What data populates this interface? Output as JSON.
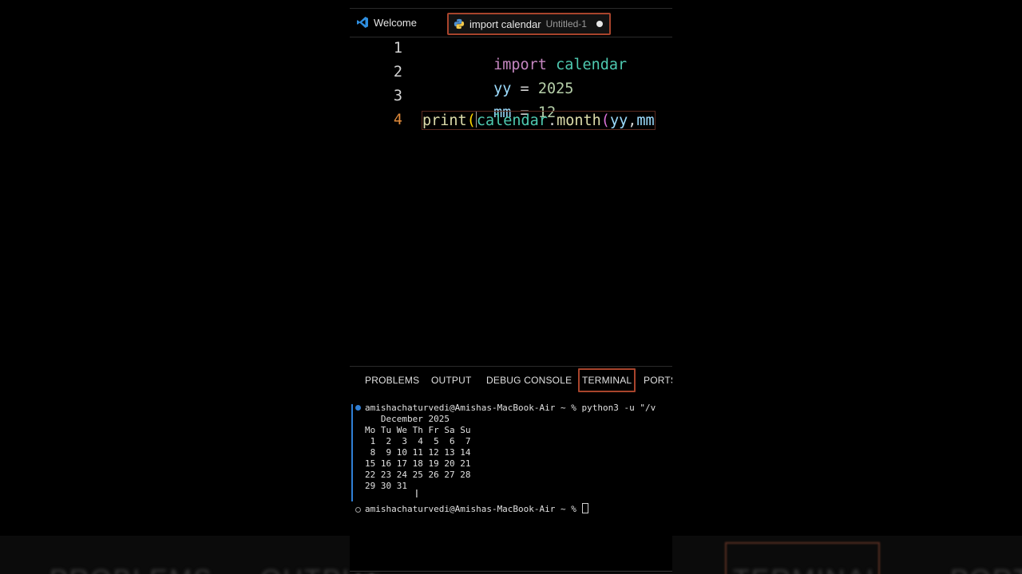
{
  "tabs": {
    "welcome": "Welcome",
    "active_title": "import calendar",
    "active_sub": "Untitled-1"
  },
  "editor": {
    "lines": [
      {
        "n": "1",
        "tokens": [
          {
            "t": "import",
            "c": "kw"
          },
          {
            "t": " ",
            "c": "op"
          },
          {
            "t": "calendar",
            "c": "mod"
          }
        ]
      },
      {
        "n": "2",
        "tokens": [
          {
            "t": "yy",
            "c": "var"
          },
          {
            "t": " = ",
            "c": "op"
          },
          {
            "t": "2025",
            "c": "num"
          }
        ]
      },
      {
        "n": "3",
        "tokens": [
          {
            "t": "mm",
            "c": "var"
          },
          {
            "t": " = ",
            "c": "op"
          },
          {
            "t": "12",
            "c": "num"
          }
        ]
      },
      {
        "n": "4",
        "tokens": [
          {
            "t": "print",
            "c": "fn"
          },
          {
            "t": "(",
            "c": "par"
          },
          {
            "t": "calendar",
            "c": "mod"
          },
          {
            "t": ".",
            "c": "op"
          },
          {
            "t": "month",
            "c": "fn"
          },
          {
            "t": "(",
            "c": "par2"
          },
          {
            "t": "yy",
            "c": "var"
          },
          {
            "t": ",",
            "c": "op"
          },
          {
            "t": "mm",
            "c": "var"
          }
        ]
      }
    ]
  },
  "panel": {
    "problems": "PROBLEMS",
    "output": "OUTPUT",
    "debug": "DEBUG CONSOLE",
    "terminal": "TERMINAL",
    "ports": "PORTS"
  },
  "terminal": {
    "command_line": "amishachaturvedi@Amishas-MacBook-Air ~ % python3 -u \"/v",
    "output": [
      "   December 2025",
      "Mo Tu We Th Fr Sa Su",
      " 1  2  3  4  5  6  7",
      " 8  9 10 11 12 13 14",
      "15 16 17 18 19 20 21",
      "22 23 24 25 26 27 28",
      "29 30 31"
    ],
    "prompt": "amishachaturvedi@Amishas-MacBook-Air ~ % "
  },
  "background": {
    "words": [
      "PROBLEMS",
      "OUTPUT",
      "TERMINAL",
      "PORTS"
    ]
  }
}
